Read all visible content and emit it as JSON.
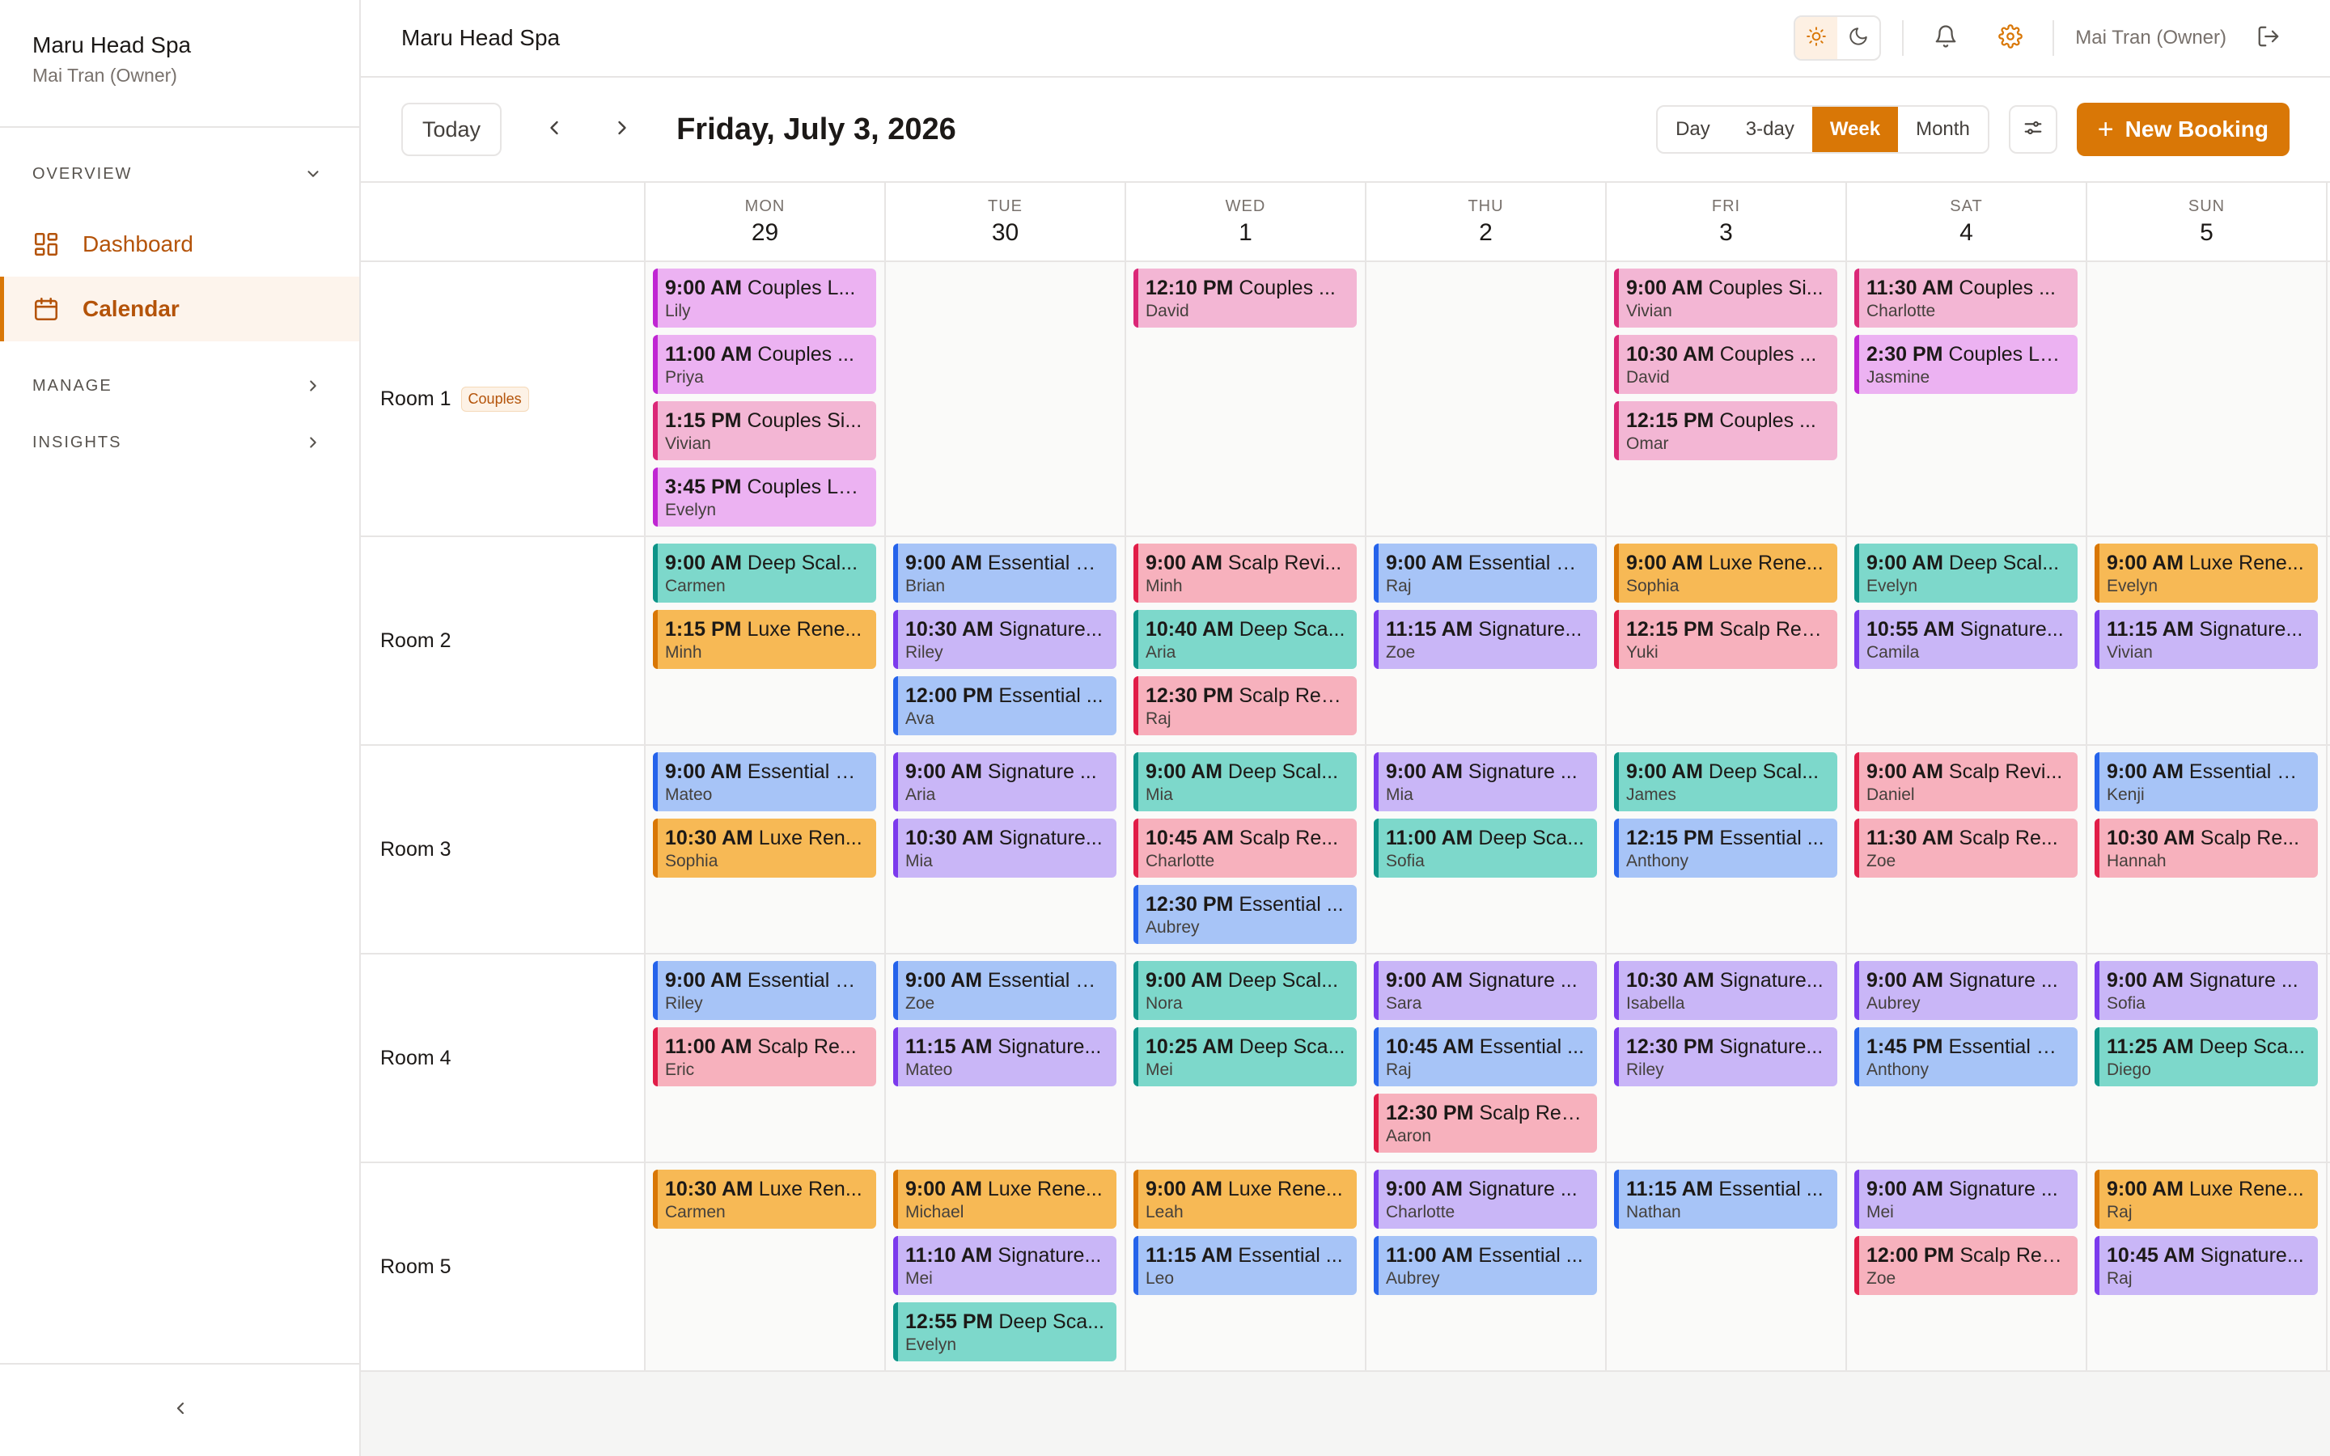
{
  "sidebar": {
    "brand": "Maru Head Spa",
    "user": "Mai Tran (Owner)",
    "sections": {
      "overview": "OVERVIEW",
      "manage": "MANAGE",
      "insights": "INSIGHTS"
    },
    "items": [
      {
        "label": "Dashboard",
        "icon": "dashboard-icon",
        "active": false
      },
      {
        "label": "Calendar",
        "icon": "calendar-icon",
        "active": true
      }
    ]
  },
  "topbar": {
    "title": "Maru Head Spa",
    "user": "Mai Tran (Owner)"
  },
  "toolbar": {
    "today": "Today",
    "date": "Friday, July 3, 2026",
    "views": [
      "Day",
      "3-day",
      "Week",
      "Month"
    ],
    "active_view": "Week",
    "new_booking": "New Booking"
  },
  "days": [
    {
      "dow": "MON",
      "num": "29"
    },
    {
      "dow": "TUE",
      "num": "30"
    },
    {
      "dow": "WED",
      "num": "1"
    },
    {
      "dow": "THU",
      "num": "2"
    },
    {
      "dow": "FRI",
      "num": "3"
    },
    {
      "dow": "SAT",
      "num": "4"
    },
    {
      "dow": "SUN",
      "num": "5"
    }
  ],
  "colors": {
    "accent": "#d97706",
    "couples_pink": "#f3b6d4",
    "couples_violet": "#ecb2f2",
    "deep_scalp": "#7dd8cb",
    "luxe_renewal": "#f7b955",
    "essential": "#a7c4f7",
    "signature": "#c9b6f7",
    "scalp_revival": "#f7b1bd"
  },
  "rooms": [
    {
      "name": "Room 1",
      "badge": "Couples",
      "days": [
        [
          {
            "time": "9:00 AM",
            "service": "Couples L...",
            "client": "Lily",
            "color": "violet"
          },
          {
            "time": "11:00 AM",
            "service": "Couples ...",
            "client": "Priya",
            "color": "violet"
          },
          {
            "time": "1:15 PM",
            "service": "Couples Si...",
            "client": "Vivian",
            "color": "pink"
          },
          {
            "time": "3:45 PM",
            "service": "Couples Lu...",
            "client": "Evelyn",
            "color": "violet"
          }
        ],
        [],
        [
          {
            "time": "12:10 PM",
            "service": "Couples ...",
            "client": "David",
            "color": "pink"
          }
        ],
        [],
        [
          {
            "time": "9:00 AM",
            "service": "Couples Si...",
            "client": "Vivian",
            "color": "pink"
          },
          {
            "time": "10:30 AM",
            "service": "Couples ...",
            "client": "David",
            "color": "pink"
          },
          {
            "time": "12:15 PM",
            "service": "Couples ...",
            "client": "Omar",
            "color": "pink"
          }
        ],
        [
          {
            "time": "11:30 AM",
            "service": "Couples ...",
            "client": "Charlotte",
            "color": "pink"
          },
          {
            "time": "2:30 PM",
            "service": "Couples Lu...",
            "client": "Jasmine",
            "color": "violet"
          }
        ],
        []
      ]
    },
    {
      "name": "Room 2",
      "badge": "",
      "days": [
        [
          {
            "time": "9:00 AM",
            "service": "Deep Scal...",
            "client": "Carmen",
            "color": "teal"
          },
          {
            "time": "1:15 PM",
            "service": "Luxe Rene...",
            "client": "Minh",
            "color": "orange"
          }
        ],
        [
          {
            "time": "9:00 AM",
            "service": "Essential R...",
            "client": "Brian",
            "color": "blue"
          },
          {
            "time": "10:30 AM",
            "service": "Signature...",
            "client": "Riley",
            "color": "purple"
          },
          {
            "time": "12:00 PM",
            "service": "Essential ...",
            "client": "Ava",
            "color": "blue"
          }
        ],
        [
          {
            "time": "9:00 AM",
            "service": "Scalp Revi...",
            "client": "Minh",
            "color": "rose"
          },
          {
            "time": "10:40 AM",
            "service": "Deep Sca...",
            "client": "Aria",
            "color": "teal"
          },
          {
            "time": "12:30 PM",
            "service": "Scalp Rev...",
            "client": "Raj",
            "color": "rose"
          }
        ],
        [
          {
            "time": "9:00 AM",
            "service": "Essential R...",
            "client": "Raj",
            "color": "blue"
          },
          {
            "time": "11:15 AM",
            "service": "Signature...",
            "client": "Zoe",
            "color": "purple"
          }
        ],
        [
          {
            "time": "9:00 AM",
            "service": "Luxe Rene...",
            "client": "Sophia",
            "color": "orange"
          },
          {
            "time": "12:15 PM",
            "service": "Scalp Rev...",
            "client": "Yuki",
            "color": "rose"
          }
        ],
        [
          {
            "time": "9:00 AM",
            "service": "Deep Scal...",
            "client": "Evelyn",
            "color": "teal"
          },
          {
            "time": "10:55 AM",
            "service": "Signature...",
            "client": "Camila",
            "color": "purple"
          }
        ],
        [
          {
            "time": "9:00 AM",
            "service": "Luxe Rene...",
            "client": "Evelyn",
            "color": "orange"
          },
          {
            "time": "11:15 AM",
            "service": "Signature...",
            "client": "Vivian",
            "color": "purple"
          }
        ]
      ]
    },
    {
      "name": "Room 3",
      "badge": "",
      "days": [
        [
          {
            "time": "9:00 AM",
            "service": "Essential R...",
            "client": "Mateo",
            "color": "blue"
          },
          {
            "time": "10:30 AM",
            "service": "Luxe Ren...",
            "client": "Sophia",
            "color": "orange"
          }
        ],
        [
          {
            "time": "9:00 AM",
            "service": "Signature ...",
            "client": "Aria",
            "color": "purple"
          },
          {
            "time": "10:30 AM",
            "service": "Signature...",
            "client": "Mia",
            "color": "purple"
          }
        ],
        [
          {
            "time": "9:00 AM",
            "service": "Deep Scal...",
            "client": "Mia",
            "color": "teal"
          },
          {
            "time": "10:45 AM",
            "service": "Scalp Re...",
            "client": "Charlotte",
            "color": "rose"
          },
          {
            "time": "12:30 PM",
            "service": "Essential ...",
            "client": "Aubrey",
            "color": "blue"
          }
        ],
        [
          {
            "time": "9:00 AM",
            "service": "Signature ...",
            "client": "Mia",
            "color": "purple"
          },
          {
            "time": "11:00 AM",
            "service": "Deep Sca...",
            "client": "Sofia",
            "color": "teal"
          }
        ],
        [
          {
            "time": "9:00 AM",
            "service": "Deep Scal...",
            "client": "James",
            "color": "teal"
          },
          {
            "time": "12:15 PM",
            "service": "Essential ...",
            "client": "Anthony",
            "color": "blue"
          }
        ],
        [
          {
            "time": "9:00 AM",
            "service": "Scalp Revi...",
            "client": "Daniel",
            "color": "rose"
          },
          {
            "time": "11:30 AM",
            "service": "Scalp Re...",
            "client": "Zoe",
            "color": "rose"
          }
        ],
        [
          {
            "time": "9:00 AM",
            "service": "Essential R...",
            "client": "Kenji",
            "color": "blue"
          },
          {
            "time": "10:30 AM",
            "service": "Scalp Re...",
            "client": "Hannah",
            "color": "rose"
          }
        ]
      ]
    },
    {
      "name": "Room 4",
      "badge": "",
      "days": [
        [
          {
            "time": "9:00 AM",
            "service": "Essential R...",
            "client": "Riley",
            "color": "blue"
          },
          {
            "time": "11:00 AM",
            "service": "Scalp Re...",
            "client": "Eric",
            "color": "rose"
          }
        ],
        [
          {
            "time": "9:00 AM",
            "service": "Essential R...",
            "client": "Zoe",
            "color": "blue"
          },
          {
            "time": "11:15 AM",
            "service": "Signature...",
            "client": "Mateo",
            "color": "purple"
          }
        ],
        [
          {
            "time": "9:00 AM",
            "service": "Deep Scal...",
            "client": "Nora",
            "color": "teal"
          },
          {
            "time": "10:25 AM",
            "service": "Deep Sca...",
            "client": "Mei",
            "color": "teal"
          }
        ],
        [
          {
            "time": "9:00 AM",
            "service": "Signature ...",
            "client": "Sara",
            "color": "purple"
          },
          {
            "time": "10:45 AM",
            "service": "Essential ...",
            "client": "Raj",
            "color": "blue"
          },
          {
            "time": "12:30 PM",
            "service": "Scalp Rev...",
            "client": "Aaron",
            "color": "rose"
          }
        ],
        [
          {
            "time": "10:30 AM",
            "service": "Signature...",
            "client": "Isabella",
            "color": "purple"
          },
          {
            "time": "12:30 PM",
            "service": "Signature...",
            "client": "Riley",
            "color": "purple"
          }
        ],
        [
          {
            "time": "9:00 AM",
            "service": "Signature ...",
            "client": "Aubrey",
            "color": "purple"
          },
          {
            "time": "1:45 PM",
            "service": "Essential R...",
            "client": "Anthony",
            "color": "blue"
          }
        ],
        [
          {
            "time": "9:00 AM",
            "service": "Signature ...",
            "client": "Sofia",
            "color": "purple"
          },
          {
            "time": "11:25 AM",
            "service": "Deep Sca...",
            "client": "Diego",
            "color": "teal"
          }
        ]
      ]
    },
    {
      "name": "Room 5",
      "badge": "",
      "days": [
        [
          {
            "time": "10:30 AM",
            "service": "Luxe Ren...",
            "client": "Carmen",
            "color": "orange"
          }
        ],
        [
          {
            "time": "9:00 AM",
            "service": "Luxe Rene...",
            "client": "Michael",
            "color": "orange"
          },
          {
            "time": "11:10 AM",
            "service": "Signature...",
            "client": "Mei",
            "color": "purple"
          },
          {
            "time": "12:55 PM",
            "service": "Deep Sca...",
            "client": "Evelyn",
            "color": "teal"
          }
        ],
        [
          {
            "time": "9:00 AM",
            "service": "Luxe Rene...",
            "client": "Leah",
            "color": "orange"
          },
          {
            "time": "11:15 AM",
            "service": "Essential ...",
            "client": "Leo",
            "color": "blue"
          }
        ],
        [
          {
            "time": "9:00 AM",
            "service": "Signature ...",
            "client": "Charlotte",
            "color": "purple"
          },
          {
            "time": "11:00 AM",
            "service": "Essential ...",
            "client": "Aubrey",
            "color": "blue"
          }
        ],
        [
          {
            "time": "11:15 AM",
            "service": "Essential ...",
            "client": "Nathan",
            "color": "blue"
          }
        ],
        [
          {
            "time": "9:00 AM",
            "service": "Signature ...",
            "client": "Mei",
            "color": "purple"
          },
          {
            "time": "12:00 PM",
            "service": "Scalp Rev...",
            "client": "Zoe",
            "color": "rose"
          }
        ],
        [
          {
            "time": "9:00 AM",
            "service": "Luxe Rene...",
            "client": "Raj",
            "color": "orange"
          },
          {
            "time": "10:45 AM",
            "service": "Signature...",
            "client": "Raj",
            "color": "purple"
          }
        ]
      ]
    }
  ]
}
